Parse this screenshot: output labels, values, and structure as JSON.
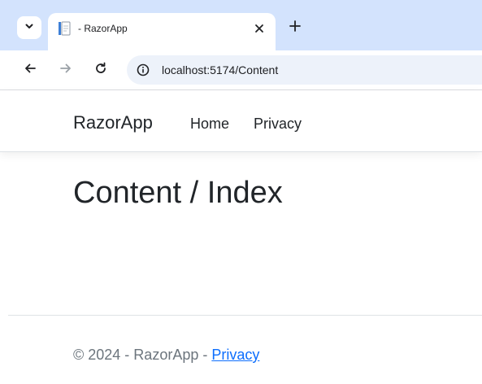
{
  "browser": {
    "tab": {
      "title": "- RazorApp",
      "favicon": "document-page-icon"
    },
    "address": {
      "url": "localhost:5174/Content"
    },
    "icons": {
      "tab_search": "chevron-down-icon",
      "close_tab": "close-icon",
      "new_tab": "plus-icon",
      "back": "arrow-left-icon",
      "forward": "arrow-right-icon",
      "reload": "reload-icon",
      "site_info": "info-icon"
    }
  },
  "site": {
    "brand": "RazorApp",
    "nav": [
      {
        "label": "Home"
      },
      {
        "label": "Privacy"
      }
    ]
  },
  "main": {
    "title": "Content / Index"
  },
  "footer": {
    "copyright": "© 2024 - RazorApp - ",
    "link": "Privacy"
  },
  "colors": {
    "tabstrip": "#d3e3fd",
    "omnibox": "#edf2fa",
    "text": "#212529",
    "muted": "#6c757d",
    "link": "#0d6efd"
  }
}
